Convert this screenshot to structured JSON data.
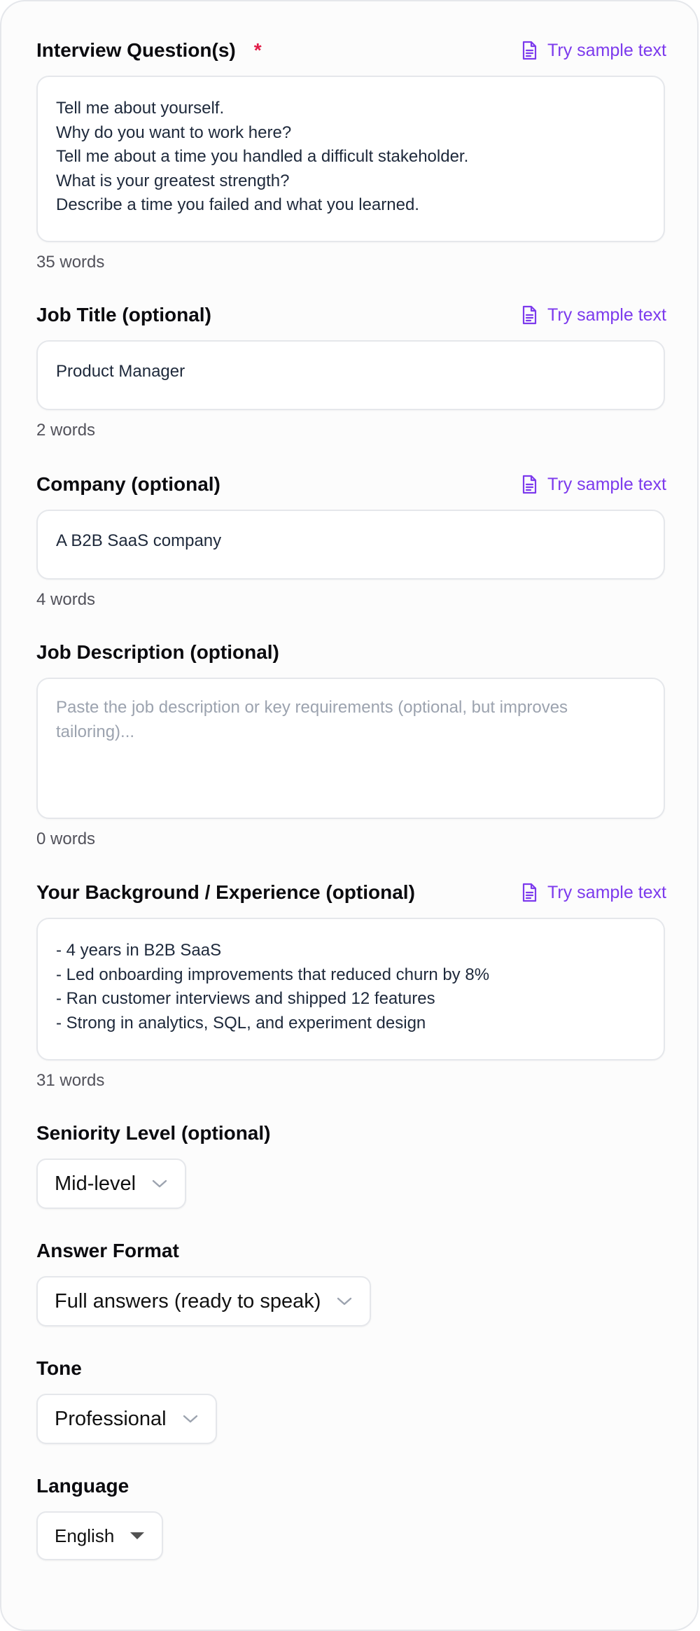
{
  "sample_label": "Try sample text",
  "questions": {
    "label": "Interview Question(s)",
    "required_mark": "*",
    "value": "Tell me about yourself.\nWhy do you want to work here?\nTell me about a time you handled a difficult stakeholder.\nWhat is your greatest strength?\nDescribe a time you failed and what you learned.",
    "count": "35 words"
  },
  "job_title": {
    "label": "Job Title (optional)",
    "value": "Product Manager",
    "count": "2 words"
  },
  "company": {
    "label": "Company (optional)",
    "value": "A B2B SaaS company",
    "count": "4 words"
  },
  "job_description": {
    "label": "Job Description (optional)",
    "placeholder": "Paste the job description or key requirements (optional, but improves tailoring)...",
    "count": "0 words"
  },
  "background": {
    "label": "Your Background / Experience (optional)",
    "value": "- 4 years in B2B SaaS\n- Led onboarding improvements that reduced churn by 8%\n- Ran customer interviews and shipped 12 features\n- Strong in analytics, SQL, and experiment design",
    "count": "31 words"
  },
  "seniority": {
    "label": "Seniority Level (optional)",
    "value": "Mid-level"
  },
  "answer_format": {
    "label": "Answer Format",
    "value": "Full answers (ready to speak)"
  },
  "tone": {
    "label": "Tone",
    "value": "Professional"
  },
  "language": {
    "label": "Language",
    "value": "English"
  },
  "colors": {
    "accent": "#7c3aed",
    "required": "#e11d48",
    "border": "#e5e7eb"
  },
  "icons": {
    "sample": "document-icon",
    "dropdown": "chevron-down-icon",
    "native_dropdown": "caret-down-icon"
  }
}
